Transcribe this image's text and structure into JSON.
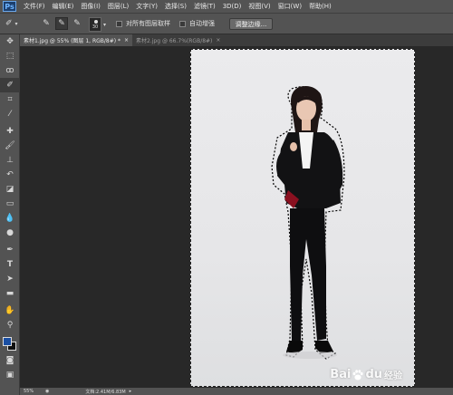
{
  "app": {
    "logo": "Ps"
  },
  "menu": [
    "文件(F)",
    "编辑(E)",
    "图像(I)",
    "图层(L)",
    "文字(Y)",
    "选择(S)",
    "滤镜(T)",
    "3D(D)",
    "视图(V)",
    "窗口(W)",
    "帮助(H)"
  ],
  "options": {
    "brush_size": "30",
    "sample_all_layers": "对所有图层取样",
    "auto_enhance": "自动增强",
    "refine_edge": "调整边缘..."
  },
  "tabs": [
    {
      "label": "素材1.jpg @ 55% (图层 1, RGB/8#) *",
      "close": "×"
    },
    {
      "label": "素材2.jpg @ 66.7%(RGB/8#)",
      "close": "×"
    }
  ],
  "tools": [
    "move-icon",
    "marquee-icon",
    "lasso-icon",
    "quick-selection-icon",
    "crop-icon",
    "eyedropper-icon",
    "healing-brush-icon",
    "brush-icon",
    "clone-stamp-icon",
    "history-brush-icon",
    "eraser-icon",
    "gradient-icon",
    "blur-icon",
    "dodge-icon",
    "pen-icon",
    "type-icon",
    "path-selection-icon",
    "shape-icon",
    "hand-icon",
    "zoom-icon"
  ],
  "colors": {
    "foreground": "#1a4fa3",
    "background": "#111111"
  },
  "watermark": {
    "brand": "Bai",
    "brand2": "du",
    "suffix": "经验"
  },
  "status": {
    "zoom": "55%",
    "doc": "文档:2.41M/6.83M"
  }
}
